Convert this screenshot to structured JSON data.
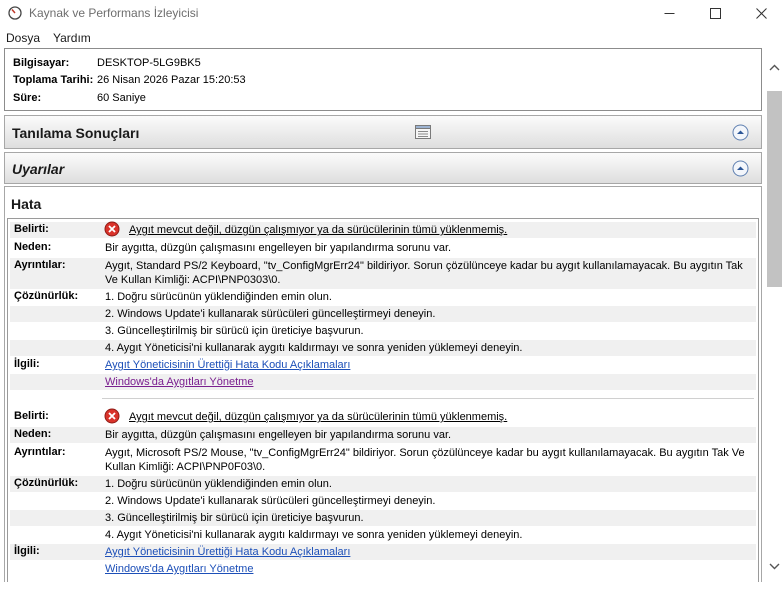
{
  "window": {
    "title": "Kaynak ve Performans İzleyicisi"
  },
  "menu": {
    "file": "Dosya",
    "help": "Yardım"
  },
  "info": {
    "computer_label": "Bilgisayar:",
    "computer_value": "DESKTOP-5LG9BK5",
    "collected_label": "Toplama Tarihi:",
    "collected_value": "26 Nisan 2026 Pazar 15:20:53",
    "duration_label": "Süre:",
    "duration_value": "60 Saniye"
  },
  "sections": {
    "diagnostics_title": "Tanılama Sonuçları",
    "warnings_title": "Uyarılar",
    "error_title": "Hata"
  },
  "labels": {
    "symptom": "Belirti:",
    "cause": "Neden:",
    "details": "Ayrıntılar:",
    "resolution": "Çözünürlük:",
    "related": "İlgili:"
  },
  "errors": [
    {
      "symptom": "Aygıt mevcut değil, düzgün çalışmıyor ya da sürücülerinin tümü yüklenmemiş.",
      "cause": "Bir aygıtta, düzgün çalışmasını engelleyen bir yapılandırma sorunu var.",
      "details": "Aygıt, Standard PS/2 Keyboard, \"tv_ConfigMgrErr24\" bildiriyor. Sorun çözülünceye kadar bu aygıt kullanılamayacak. Bu aygıtın Tak Ve Kullan Kimliği: ACPI\\PNP0303\\0.",
      "resolution": [
        "1. Doğru sürücünün yüklendiğinden emin olun.",
        "2. Windows Update'i kullanarak sürücüleri güncelleştirmeyi deneyin.",
        "3. Güncelleştirilmiş bir sürücü için üreticiye başvurun.",
        "4. Aygıt Yöneticisi'ni kullanarak aygıtı kaldırmayı ve sonra yeniden yüklemeyi deneyin."
      ],
      "related": [
        "Aygıt Yöneticisinin Ürettiği Hata Kodu Açıklamaları",
        "Windows'da Aygıtları Yönetme"
      ]
    },
    {
      "symptom": "Aygıt mevcut değil, düzgün çalışmıyor ya da sürücülerinin tümü yüklenmemiş.",
      "cause": "Bir aygıtta, düzgün çalışmasını engelleyen bir yapılandırma sorunu var.",
      "details": "Aygıt, Microsoft PS/2 Mouse, \"tv_ConfigMgrErr24\" bildiriyor. Sorun çözülünceye kadar bu aygıt kullanılamayacak. Bu aygıtın Tak Ve Kullan Kimliği: ACPI\\PNP0F03\\0.",
      "resolution": [
        "1. Doğru sürücünün yüklendiğinden emin olun.",
        "2. Windows Update'i kullanarak sürücüleri güncelleştirmeyi deneyin.",
        "3. Güncelleştirilmiş bir sürücü için üreticiye başvurun.",
        "4. Aygıt Yöneticisi'ni kullanarak aygıtı kaldırmayı ve sonra yeniden yüklemeyi deneyin."
      ],
      "related": [
        "Aygıt Yöneticisinin Ürettiği Hata Kodu Açıklamaları",
        "Windows'da Aygıtları Yönetme"
      ]
    }
  ],
  "colors": {
    "link": "#1c4fb8",
    "visited_link": "#7a1f8f",
    "error_red": "#d9332b"
  },
  "icons": {
    "app": "resource-monitor-icon",
    "error": "error-icon",
    "collapse": "collapse-up-icon",
    "report": "report-icon"
  }
}
